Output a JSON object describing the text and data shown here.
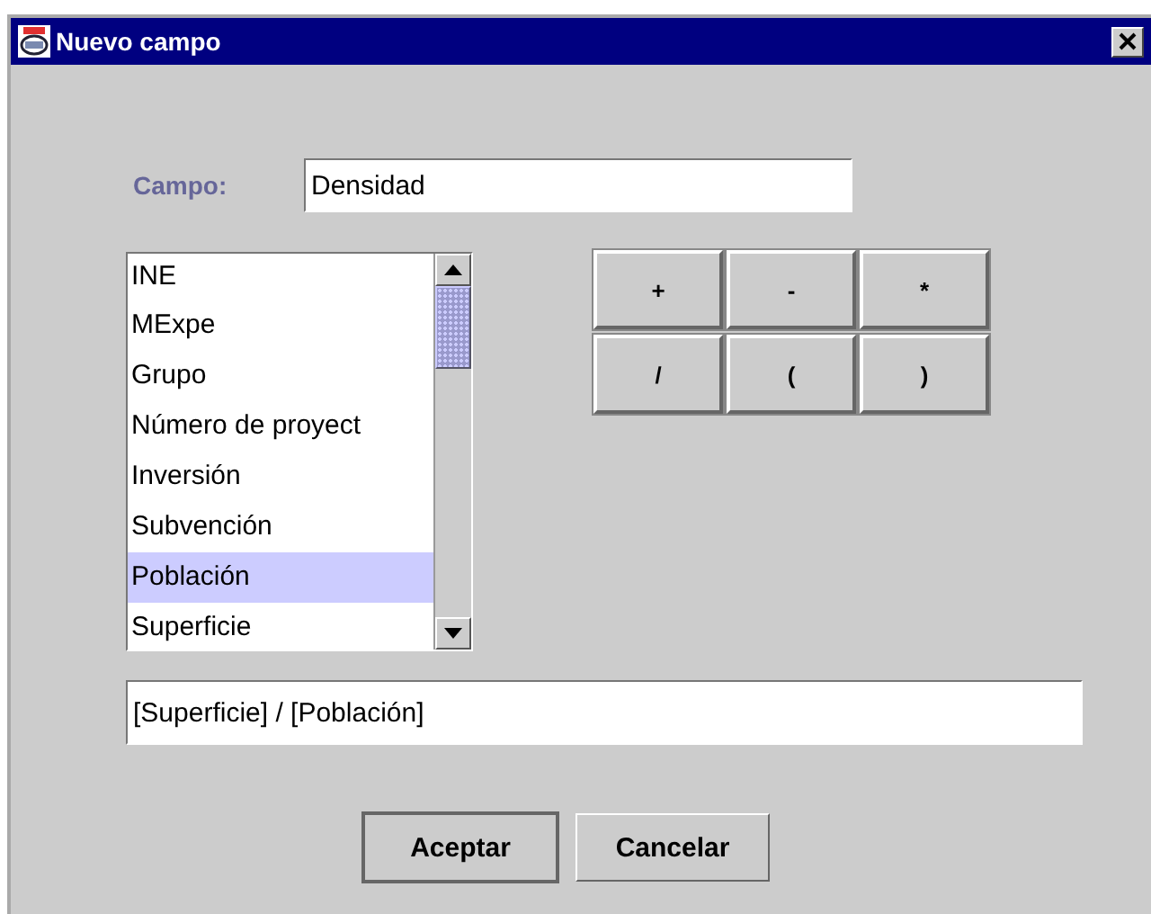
{
  "window": {
    "title": "Nuevo campo"
  },
  "campo": {
    "label": "Campo:",
    "value": "Densidad"
  },
  "fields_list": [
    {
      "label": "INE",
      "selected": false
    },
    {
      "label": "MExpe",
      "selected": false
    },
    {
      "label": "Grupo",
      "selected": false
    },
    {
      "label": "Número de proyect",
      "selected": false
    },
    {
      "label": "Inversión",
      "selected": false
    },
    {
      "label": "Subvención",
      "selected": false
    },
    {
      "label": "Población",
      "selected": true
    },
    {
      "label": "Superficie",
      "selected": false
    }
  ],
  "operators": [
    "+",
    "-",
    "*",
    "/",
    "(",
    ")"
  ],
  "formula": {
    "value": "[Superficie] / [Población]"
  },
  "buttons": [
    {
      "label": "Aceptar",
      "default": true
    },
    {
      "label": "Cancelar",
      "default": false
    }
  ]
}
